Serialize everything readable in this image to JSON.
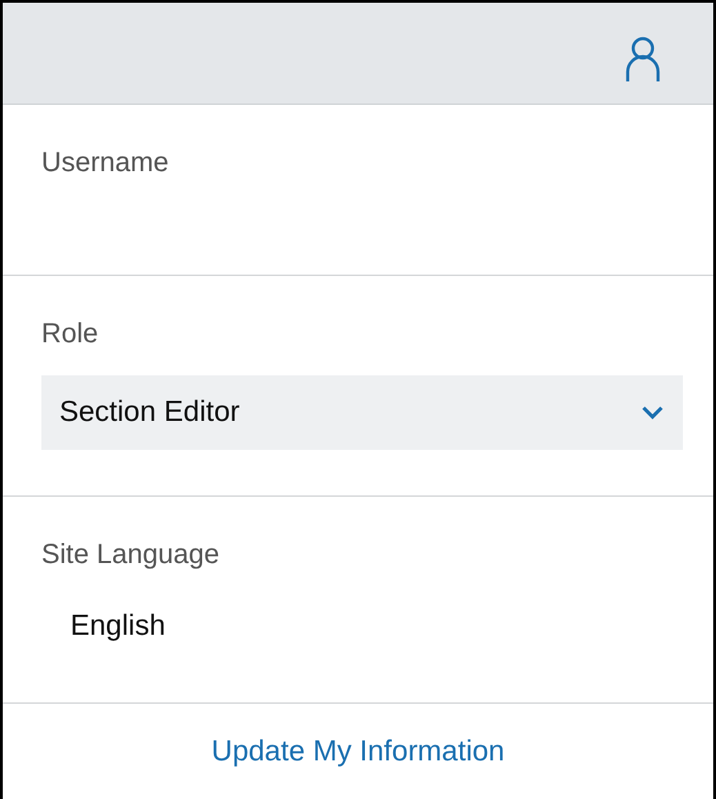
{
  "username": {
    "label": "Username"
  },
  "role": {
    "label": "Role",
    "value": "Section Editor"
  },
  "site_language": {
    "label": "Site Language",
    "value": "English"
  },
  "update_link": "Update My Information"
}
